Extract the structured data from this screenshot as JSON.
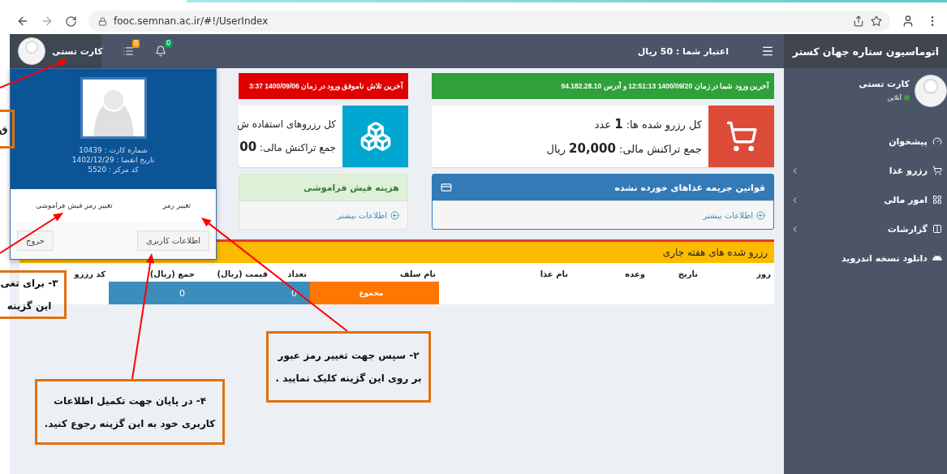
{
  "browser": {
    "url": "fooc.semnan.ac.ir/#!/UserIndex"
  },
  "navbar": {
    "user_name": "کارت تستی",
    "badges": [
      {
        "kind": "bell",
        "count": "0",
        "color": "#00a65a"
      },
      {
        "kind": "list",
        "count": "0",
        "color": "#f39c12"
      }
    ],
    "credit": "اعتبار شما : 50 ریال"
  },
  "sidebar": {
    "title": "اتوماسیون ستاره جهان کستر",
    "user_name": "کارت تستی",
    "status": "آنلاین",
    "items": [
      {
        "kind": "dashboard",
        "label": "پیشخوان",
        "expandable": false
      },
      {
        "kind": "cart",
        "label": "رزرو غذا",
        "expandable": true
      },
      {
        "kind": "grid",
        "label": "امور مالی",
        "expandable": true
      },
      {
        "kind": "columns",
        "label": "گزارشات",
        "expandable": true
      },
      {
        "kind": "android",
        "label": "دانلود نسخه اندروید",
        "expandable": false
      }
    ]
  },
  "user_menu": {
    "lines": [
      "شماره کارت : 10439",
      "تاریخ انقضا : 1402/12/29",
      "کد مرکز : 5520"
    ],
    "links": [
      "تغییر رمز",
      "تغییر رمز فیش فراموشی"
    ],
    "buttons": [
      "اطلاعات کاربری",
      "خروج"
    ]
  },
  "alerts": [
    {
      "kind": "success",
      "text": "آخرین ورود شما در زمان 1400/09/20 12:51:13 و آدرس 94.182.28.10"
    },
    {
      "kind": "danger",
      "text": "آخرین تلاش ناموفق ورود در زمان 1400/09/06 3:37"
    }
  ],
  "stats": [
    {
      "kind": "cart",
      "lines": [
        "کل رزرو شده ها: **1** عدد",
        "جمع تراکنش مالی: **20,000** ریال"
      ]
    },
    {
      "kind": "cubes",
      "lines": [
        "کل رزروهای استفاده ش",
        "جمع تراکنش مالی: **00**"
      ]
    }
  ],
  "panels": [
    {
      "kind": "primary",
      "title": "قوانین جریمه غذاهای خورده نشده",
      "link": "اطلاعات بیشتر"
    },
    {
      "kind": "success",
      "title": "هزینه فیش فراموشی",
      "link": "اطلاعات بیشتر"
    }
  ],
  "weekly_table": {
    "title": "رزرو شده های هفته جاری",
    "columns": [
      "روز",
      "تاریخ",
      "وعده",
      "نام غذا",
      "نام سلف",
      "تعداد",
      "قیمت (ریال)",
      "جمع (ریال)",
      "کد رزرو"
    ],
    "total_row": [
      {
        "kind": "blank"
      },
      {
        "kind": "blank"
      },
      {
        "kind": "blank"
      },
      {
        "kind": "blank"
      },
      {
        "kind": "label",
        "text": "مجموع"
      },
      {
        "kind": "value",
        "text": "0"
      },
      {
        "kind": "value"
      },
      {
        "kind": "value",
        "text": "0"
      },
      {
        "kind": "blank"
      }
    ]
  },
  "callouts": [
    {
      "lines": [
        "ق"
      ]
    },
    {
      "lines": [
        "۳- برای تغی",
        "این گزینه"
      ]
    },
    {
      "lines": [
        "۲- سپس جهت تغییر رمز عبور",
        "بر روی این گزینه کلیک نمایید ."
      ]
    },
    {
      "lines": [
        "۴- در پایان جهت تکمیل اطلاعات",
        "کاربری خود به این گزینه رجوع کنید."
      ]
    }
  ]
}
